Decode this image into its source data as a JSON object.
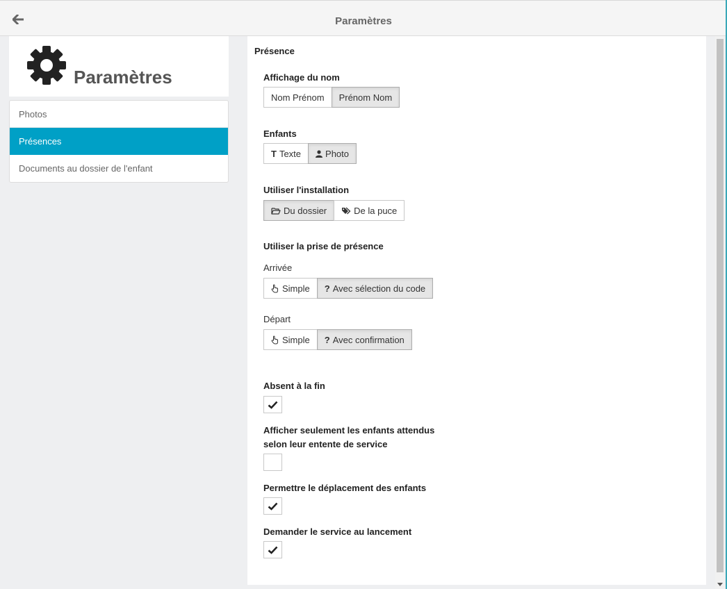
{
  "header": {
    "title": "Paramètres",
    "back_icon": "arrow-left-icon"
  },
  "sidebar": {
    "title": "Paramètres",
    "icon": "gear-icon",
    "items": [
      {
        "label": "Photos",
        "active": false
      },
      {
        "label": "Présences",
        "active": true
      },
      {
        "label": "Documents au dossier de l'enfant",
        "active": false
      }
    ]
  },
  "accent_color": "#00a0c6",
  "main": {
    "section_title": "Présence",
    "name_display": {
      "label": "Affichage du nom",
      "options": [
        "Nom Prénom",
        "Prénom Nom"
      ],
      "selected": "Prénom Nom"
    },
    "children": {
      "label": "Enfants",
      "text_glyph": "T",
      "options": [
        "Texte",
        "Photo"
      ],
      "selected": "Photo"
    },
    "installation": {
      "label": "Utiliser l'installation",
      "options": [
        "Du dossier",
        "De la puce"
      ],
      "selected": "Du dossier"
    },
    "presence": {
      "label": "Utiliser la prise de présence",
      "arrival": {
        "label": "Arrivée",
        "glyph": "?",
        "options": [
          "Simple",
          "Avec sélection du code"
        ],
        "selected": "Avec sélection du code"
      },
      "departure": {
        "label": "Départ",
        "glyph": "?",
        "options": [
          "Simple",
          "Avec confirmation"
        ],
        "selected": "Avec confirmation"
      }
    },
    "absent_end": {
      "label": "Absent à la fin",
      "checked": true
    },
    "expected_only": {
      "label_line1": "Afficher seulement les enfants attendus",
      "label_line2": "selon leur entente de service",
      "checked": false
    },
    "allow_move": {
      "label": "Permettre le déplacement des enfants",
      "checked": true
    },
    "ask_service": {
      "label": "Demander le service au lancement",
      "checked": true
    }
  }
}
